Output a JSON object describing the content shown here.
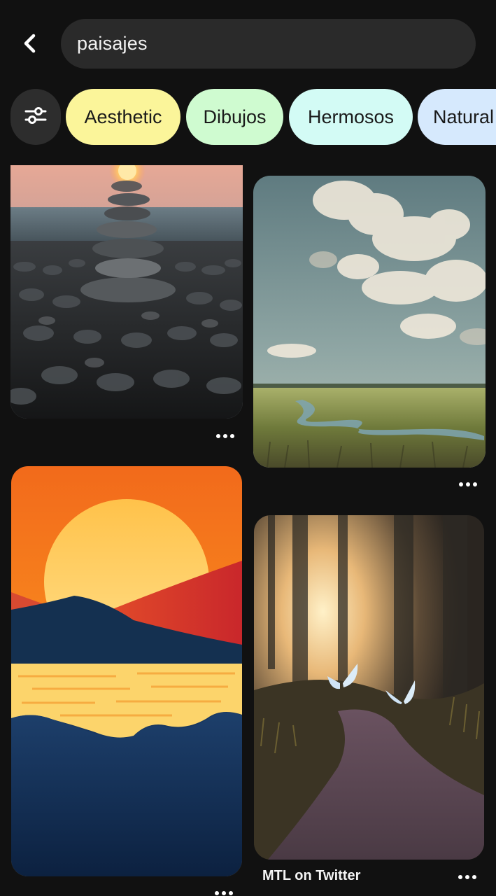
{
  "search": {
    "query": "paisajes"
  },
  "icons": {
    "back": "chevron-left-icon",
    "filter": "sliders-icon",
    "more": "more-horizontal-icon"
  },
  "chips": [
    {
      "label": "Aesthetic",
      "color": "#fbf59a"
    },
    {
      "label": "Dibujos",
      "color": "#cffbd0"
    },
    {
      "label": "Hermosos",
      "color": "#d3fbf5"
    },
    {
      "label": "Natural",
      "color": "#d6e9fd"
    }
  ],
  "pins": [
    {
      "subject": "stacked-stones-sunset"
    },
    {
      "subject": "painted-marsh-clouds"
    },
    {
      "subject": "vector-sunset-lake"
    },
    {
      "subject": "forest-path-butterflies",
      "caption": "MTL on Twitter"
    }
  ]
}
